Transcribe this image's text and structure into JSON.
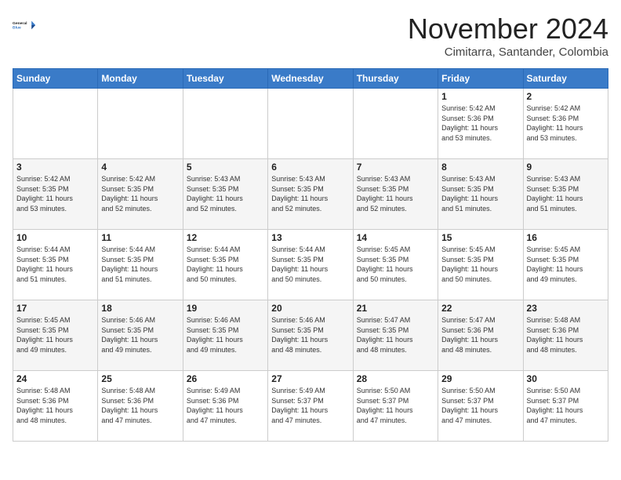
{
  "header": {
    "logo_line1": "General",
    "logo_line2": "Blue",
    "month_title": "November 2024",
    "location": "Cimitarra, Santander, Colombia"
  },
  "weekdays": [
    "Sunday",
    "Monday",
    "Tuesday",
    "Wednesday",
    "Thursday",
    "Friday",
    "Saturday"
  ],
  "weeks": [
    [
      {
        "day": "",
        "info": ""
      },
      {
        "day": "",
        "info": ""
      },
      {
        "day": "",
        "info": ""
      },
      {
        "day": "",
        "info": ""
      },
      {
        "day": "",
        "info": ""
      },
      {
        "day": "1",
        "info": "Sunrise: 5:42 AM\nSunset: 5:36 PM\nDaylight: 11 hours\nand 53 minutes."
      },
      {
        "day": "2",
        "info": "Sunrise: 5:42 AM\nSunset: 5:36 PM\nDaylight: 11 hours\nand 53 minutes."
      }
    ],
    [
      {
        "day": "3",
        "info": "Sunrise: 5:42 AM\nSunset: 5:35 PM\nDaylight: 11 hours\nand 53 minutes."
      },
      {
        "day": "4",
        "info": "Sunrise: 5:42 AM\nSunset: 5:35 PM\nDaylight: 11 hours\nand 52 minutes."
      },
      {
        "day": "5",
        "info": "Sunrise: 5:43 AM\nSunset: 5:35 PM\nDaylight: 11 hours\nand 52 minutes."
      },
      {
        "day": "6",
        "info": "Sunrise: 5:43 AM\nSunset: 5:35 PM\nDaylight: 11 hours\nand 52 minutes."
      },
      {
        "day": "7",
        "info": "Sunrise: 5:43 AM\nSunset: 5:35 PM\nDaylight: 11 hours\nand 52 minutes."
      },
      {
        "day": "8",
        "info": "Sunrise: 5:43 AM\nSunset: 5:35 PM\nDaylight: 11 hours\nand 51 minutes."
      },
      {
        "day": "9",
        "info": "Sunrise: 5:43 AM\nSunset: 5:35 PM\nDaylight: 11 hours\nand 51 minutes."
      }
    ],
    [
      {
        "day": "10",
        "info": "Sunrise: 5:44 AM\nSunset: 5:35 PM\nDaylight: 11 hours\nand 51 minutes."
      },
      {
        "day": "11",
        "info": "Sunrise: 5:44 AM\nSunset: 5:35 PM\nDaylight: 11 hours\nand 51 minutes."
      },
      {
        "day": "12",
        "info": "Sunrise: 5:44 AM\nSunset: 5:35 PM\nDaylight: 11 hours\nand 50 minutes."
      },
      {
        "day": "13",
        "info": "Sunrise: 5:44 AM\nSunset: 5:35 PM\nDaylight: 11 hours\nand 50 minutes."
      },
      {
        "day": "14",
        "info": "Sunrise: 5:45 AM\nSunset: 5:35 PM\nDaylight: 11 hours\nand 50 minutes."
      },
      {
        "day": "15",
        "info": "Sunrise: 5:45 AM\nSunset: 5:35 PM\nDaylight: 11 hours\nand 50 minutes."
      },
      {
        "day": "16",
        "info": "Sunrise: 5:45 AM\nSunset: 5:35 PM\nDaylight: 11 hours\nand 49 minutes."
      }
    ],
    [
      {
        "day": "17",
        "info": "Sunrise: 5:45 AM\nSunset: 5:35 PM\nDaylight: 11 hours\nand 49 minutes."
      },
      {
        "day": "18",
        "info": "Sunrise: 5:46 AM\nSunset: 5:35 PM\nDaylight: 11 hours\nand 49 minutes."
      },
      {
        "day": "19",
        "info": "Sunrise: 5:46 AM\nSunset: 5:35 PM\nDaylight: 11 hours\nand 49 minutes."
      },
      {
        "day": "20",
        "info": "Sunrise: 5:46 AM\nSunset: 5:35 PM\nDaylight: 11 hours\nand 48 minutes."
      },
      {
        "day": "21",
        "info": "Sunrise: 5:47 AM\nSunset: 5:35 PM\nDaylight: 11 hours\nand 48 minutes."
      },
      {
        "day": "22",
        "info": "Sunrise: 5:47 AM\nSunset: 5:36 PM\nDaylight: 11 hours\nand 48 minutes."
      },
      {
        "day": "23",
        "info": "Sunrise: 5:48 AM\nSunset: 5:36 PM\nDaylight: 11 hours\nand 48 minutes."
      }
    ],
    [
      {
        "day": "24",
        "info": "Sunrise: 5:48 AM\nSunset: 5:36 PM\nDaylight: 11 hours\nand 48 minutes."
      },
      {
        "day": "25",
        "info": "Sunrise: 5:48 AM\nSunset: 5:36 PM\nDaylight: 11 hours\nand 47 minutes."
      },
      {
        "day": "26",
        "info": "Sunrise: 5:49 AM\nSunset: 5:36 PM\nDaylight: 11 hours\nand 47 minutes."
      },
      {
        "day": "27",
        "info": "Sunrise: 5:49 AM\nSunset: 5:37 PM\nDaylight: 11 hours\nand 47 minutes."
      },
      {
        "day": "28",
        "info": "Sunrise: 5:50 AM\nSunset: 5:37 PM\nDaylight: 11 hours\nand 47 minutes."
      },
      {
        "day": "29",
        "info": "Sunrise: 5:50 AM\nSunset: 5:37 PM\nDaylight: 11 hours\nand 47 minutes."
      },
      {
        "day": "30",
        "info": "Sunrise: 5:50 AM\nSunset: 5:37 PM\nDaylight: 11 hours\nand 47 minutes."
      }
    ]
  ]
}
